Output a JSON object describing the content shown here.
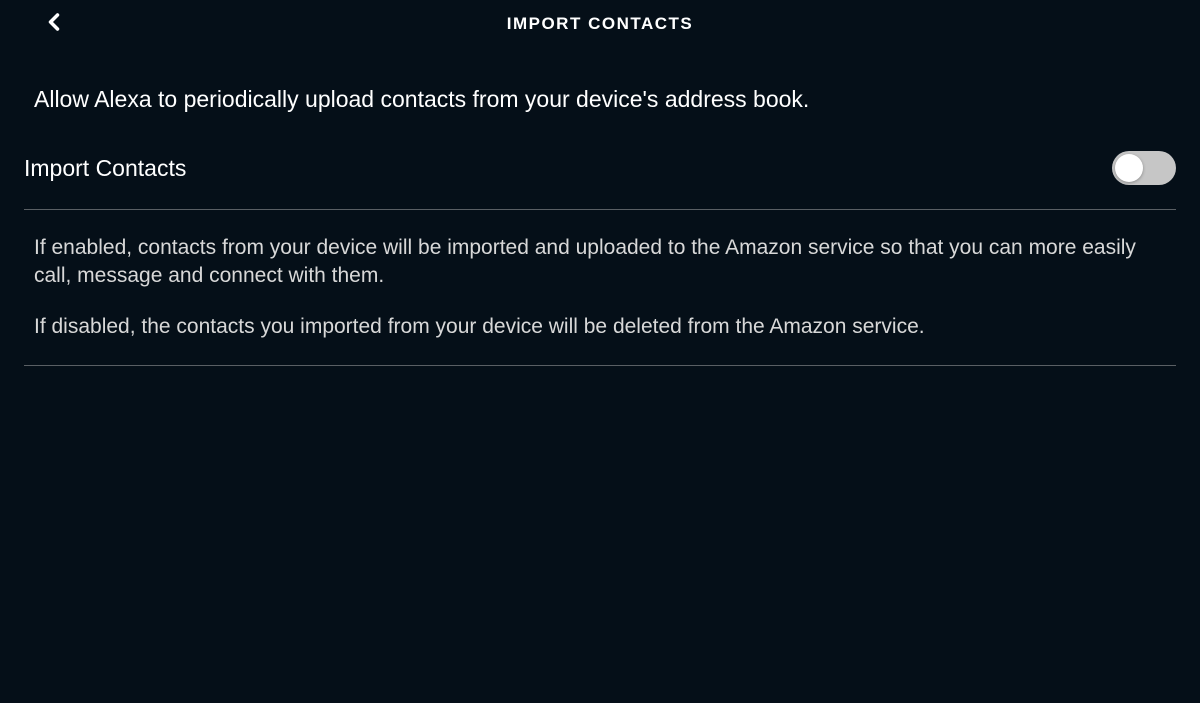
{
  "header": {
    "title": "IMPORT CONTACTS"
  },
  "description": "Allow Alexa to periodically upload contacts from your device's address book.",
  "toggle": {
    "label": "Import Contacts",
    "state": "off"
  },
  "explanation": {
    "enabled_text": "If enabled, contacts from your device will be imported and uploaded to the Amazon service so that you can more easily call, message and connect with them.",
    "disabled_text": "If disabled, the contacts you imported from your device will be deleted from the Amazon service."
  }
}
